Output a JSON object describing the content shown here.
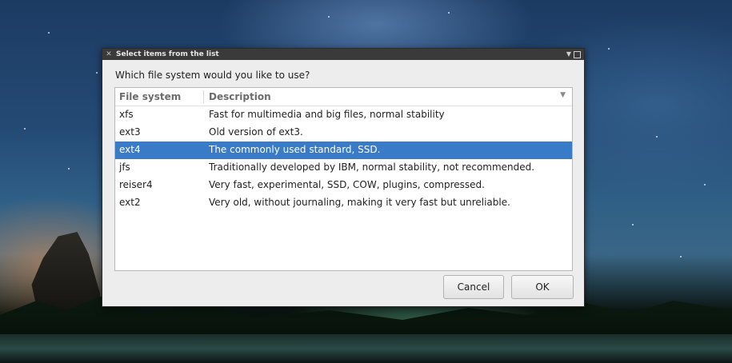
{
  "dialog": {
    "title": "Select items from the list",
    "prompt": "Which file system would you like to use?",
    "columns": [
      "File system",
      "Description"
    ],
    "rows": [
      {
        "fs": "xfs",
        "desc": "Fast for multimedia and big files, normal stability"
      },
      {
        "fs": "ext3",
        "desc": "Old version of ext3."
      },
      {
        "fs": "ext4",
        "desc": "The commonly used standard, SSD."
      },
      {
        "fs": "jfs",
        "desc": "Traditionally developed by IBM, normal stability, not recommended."
      },
      {
        "fs": "reiser4",
        "desc": "Very fast, experimental, SSD, COW, plugins, compressed."
      },
      {
        "fs": "ext2",
        "desc": "Very old, without journaling, making it very fast but unreliable."
      }
    ],
    "selected_index": 2,
    "buttons": {
      "cancel": "Cancel",
      "ok": "OK"
    },
    "icons": {
      "close": "close-icon",
      "menu": "dropdown-arrow-icon",
      "maximize": "maximize-icon",
      "sort": "sort-arrow-icon"
    },
    "colors": {
      "selection": "#3a7bc8",
      "titlebar": "#3a3a3a",
      "window": "#ededed"
    }
  }
}
